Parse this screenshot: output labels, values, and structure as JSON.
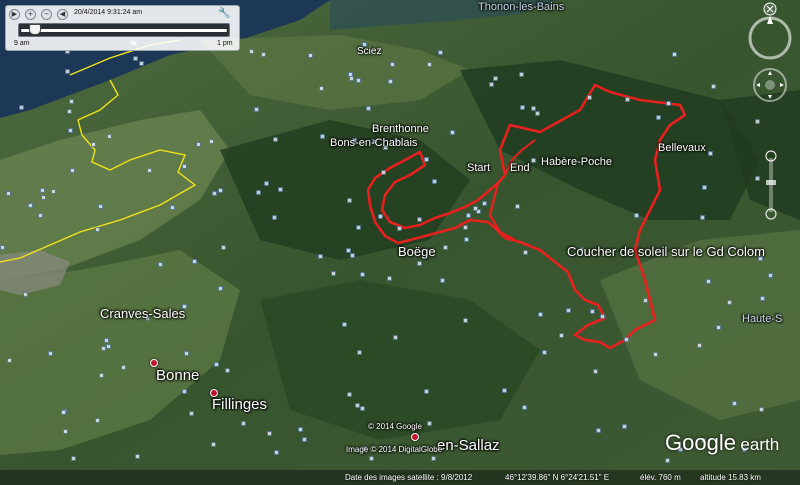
{
  "time_slider": {
    "datetime": "20/4/2014   9:31:24 am",
    "start_label": "9 am",
    "end_label": "1 pm",
    "position": 0.05
  },
  "places": {
    "thonon": "Thonon-les-Bains",
    "sciez": "Sciez",
    "brenthonne": "Brenthonne",
    "bons": "Bons-en-Chablais",
    "start": "Start",
    "end": "End",
    "habere": "Habère-Poche",
    "bellevaux": "Bellevaux",
    "boege": "Boëge",
    "coucher": "Coucher de soleil sur le Gd Colom",
    "haute": "Haute-S",
    "cranves": "Cranves-Sales",
    "bonne": "Bonne",
    "fillinges": "Fillinges",
    "sallaz": "en-Sallaz"
  },
  "copyright": {
    "google": "© 2014 Google",
    "image": "Image © 2014 DigitalGlobe"
  },
  "status": {
    "imagery_date": "Date des images satellite : 9/8/2012",
    "coordinates": "46°12'39.86\" N    6°24'21.51\" E",
    "elevation": "élév.   760 m",
    "altitude": "altitude   15.83 km"
  },
  "logo": {
    "google": "Google",
    "earth": "earth"
  },
  "colors": {
    "track": "#e8201e",
    "border": "#f2e21a",
    "lake": "#1c3658",
    "forest": "#2c4a28",
    "field": "#6f8a52"
  },
  "icons": [
    "play-icon",
    "zoom-in-icon",
    "zoom-out-icon",
    "rewind-icon",
    "settings-wrench-icon",
    "close-icon",
    "compass-icon",
    "look-joystick-icon",
    "zoom-slider-icon",
    "photo-marker-icon",
    "museum-icon",
    "place-pin-icon"
  ]
}
